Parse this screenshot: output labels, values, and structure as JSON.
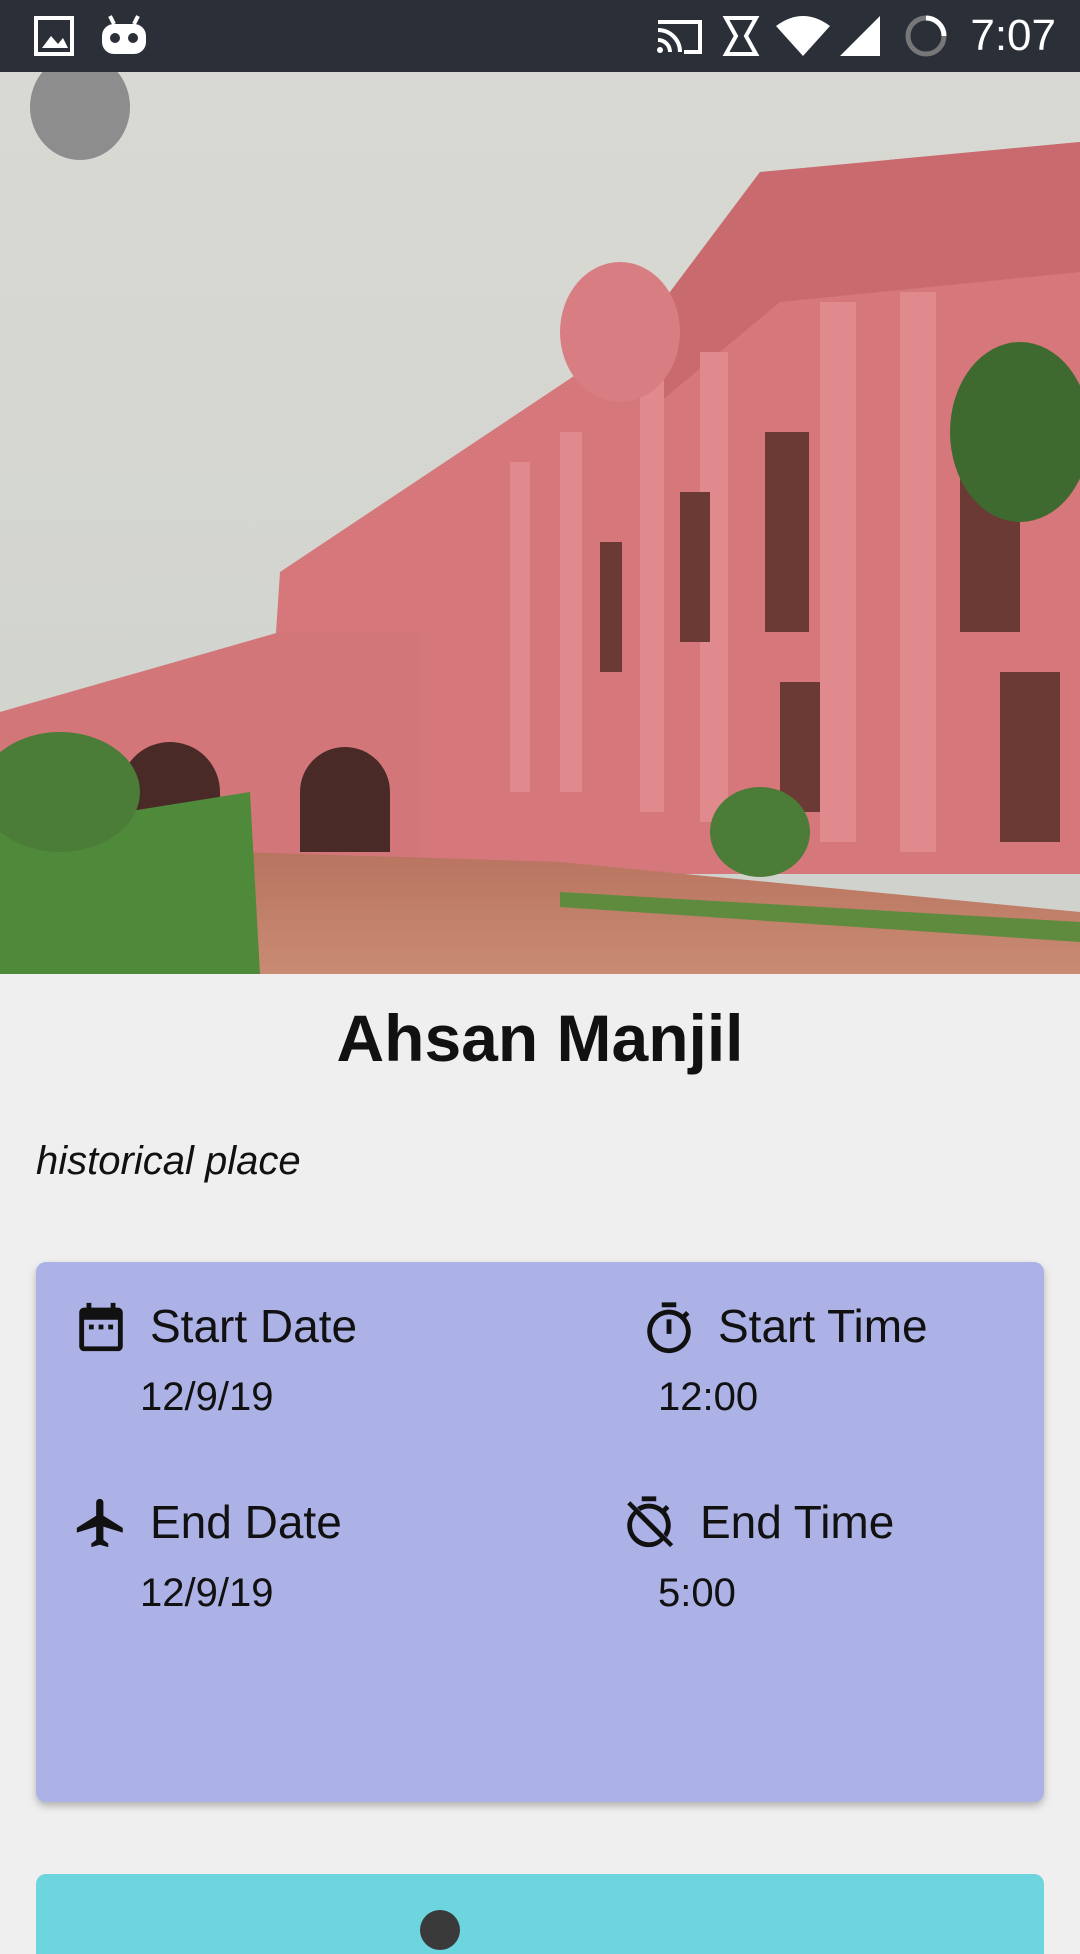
{
  "status_bar": {
    "time": "7:07",
    "icons": [
      "gallery-icon",
      "android-icon",
      "cast-icon",
      "sync-icon",
      "wifi-icon",
      "signal-icon",
      "loading-icon"
    ]
  },
  "place": {
    "name": "Ahsan Manjil",
    "category": "historical place"
  },
  "schedule": {
    "start_date": {
      "label": "Start Date",
      "value": "12/9/19",
      "icon": "calendar-icon"
    },
    "start_time": {
      "label": "Start Time",
      "value": "12:00",
      "icon": "stopwatch-icon"
    },
    "end_date": {
      "label": "End Date",
      "value": "12/9/19",
      "icon": "airplane-icon"
    },
    "end_time": {
      "label": "End Time",
      "value": "5:00",
      "icon": "timer-off-icon"
    }
  },
  "colors": {
    "status_bar": "#2b2f38",
    "background": "#efefef",
    "schedule_card": "#adb2e6",
    "next_card": "#6dd5dd"
  }
}
